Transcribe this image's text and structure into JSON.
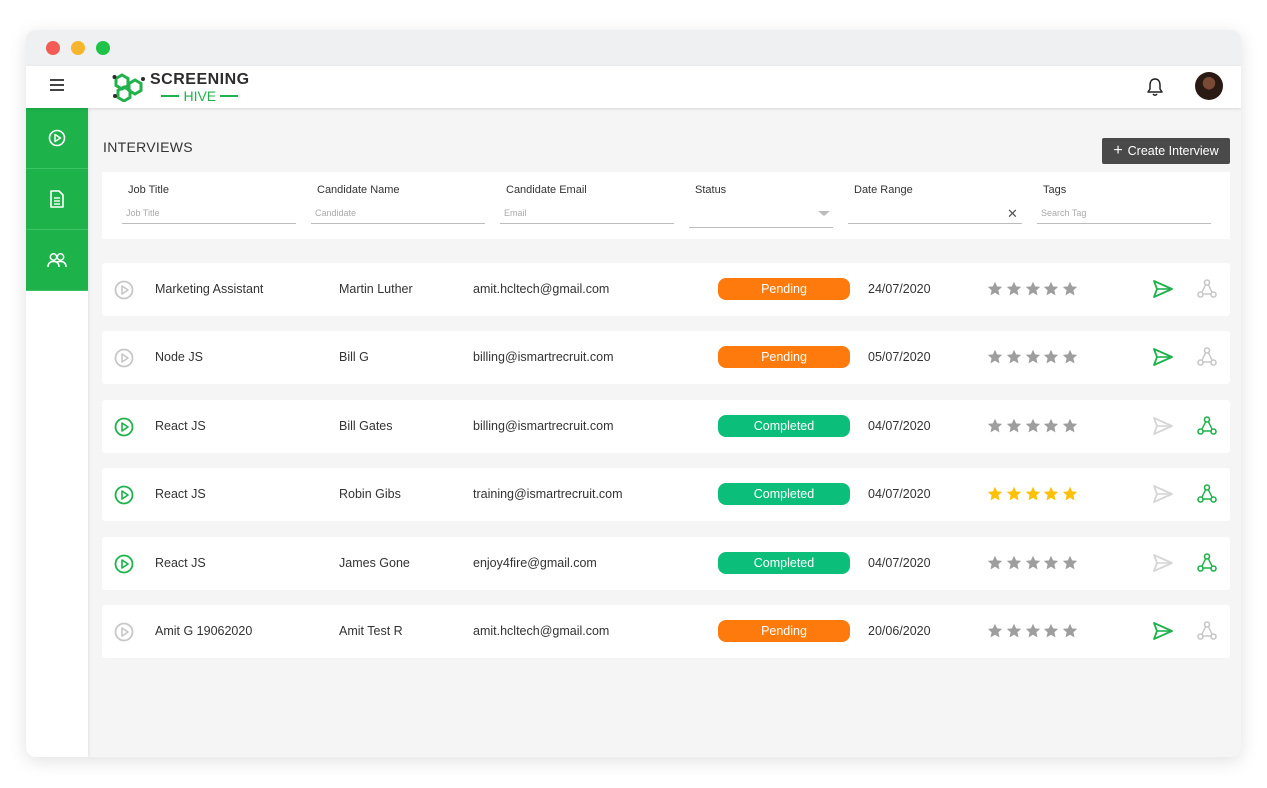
{
  "app": {
    "logo_top": "SCREENING",
    "logo_bottom": "HIVE"
  },
  "page": {
    "title": "INTERVIEWS",
    "create_button": "Create Interview"
  },
  "filters": {
    "job_title": {
      "label": "Job Title",
      "placeholder": "Job Title"
    },
    "candidate_name": {
      "label": "Candidate Name",
      "placeholder": "Candidate"
    },
    "candidate_email": {
      "label": "Candidate Email",
      "placeholder": "Email"
    },
    "status": {
      "label": "Status",
      "placeholder": ""
    },
    "date_range": {
      "label": "Date Range",
      "placeholder": ""
    },
    "tags": {
      "label": "Tags",
      "placeholder": "Search Tag"
    }
  },
  "colors": {
    "brand": "#1eb24b",
    "pending": "#ff7a0c",
    "completed": "#0bbf7a",
    "star_empty": "#9e9e9e",
    "star_filled": "#ffc107"
  },
  "rows": [
    {
      "job": "Marketing Assistant",
      "candidate": "Martin Luther",
      "email": "amit.hcltech@gmail.com",
      "status": "Pending",
      "date": "24/07/2020",
      "rating": 0
    },
    {
      "job": "Node JS",
      "candidate": "Bill G",
      "email": "billing@ismartrecruit.com",
      "status": "Pending",
      "date": "05/07/2020",
      "rating": 0
    },
    {
      "job": "React JS",
      "candidate": "Bill Gates",
      "email": "billing@ismartrecruit.com",
      "status": "Completed",
      "date": "04/07/2020",
      "rating": 0
    },
    {
      "job": "React JS",
      "candidate": "Robin Gibs",
      "email": "training@ismartrecruit.com",
      "status": "Completed",
      "date": "04/07/2020",
      "rating": 5
    },
    {
      "job": "React JS",
      "candidate": "James Gone",
      "email": "enjoy4fire@gmail.com",
      "status": "Completed",
      "date": "04/07/2020",
      "rating": 0
    },
    {
      "job": "Amit G 19062020",
      "candidate": "Amit Test R",
      "email": "amit.hcltech@gmail.com",
      "status": "Pending",
      "date": "20/06/2020",
      "rating": 0
    }
  ]
}
